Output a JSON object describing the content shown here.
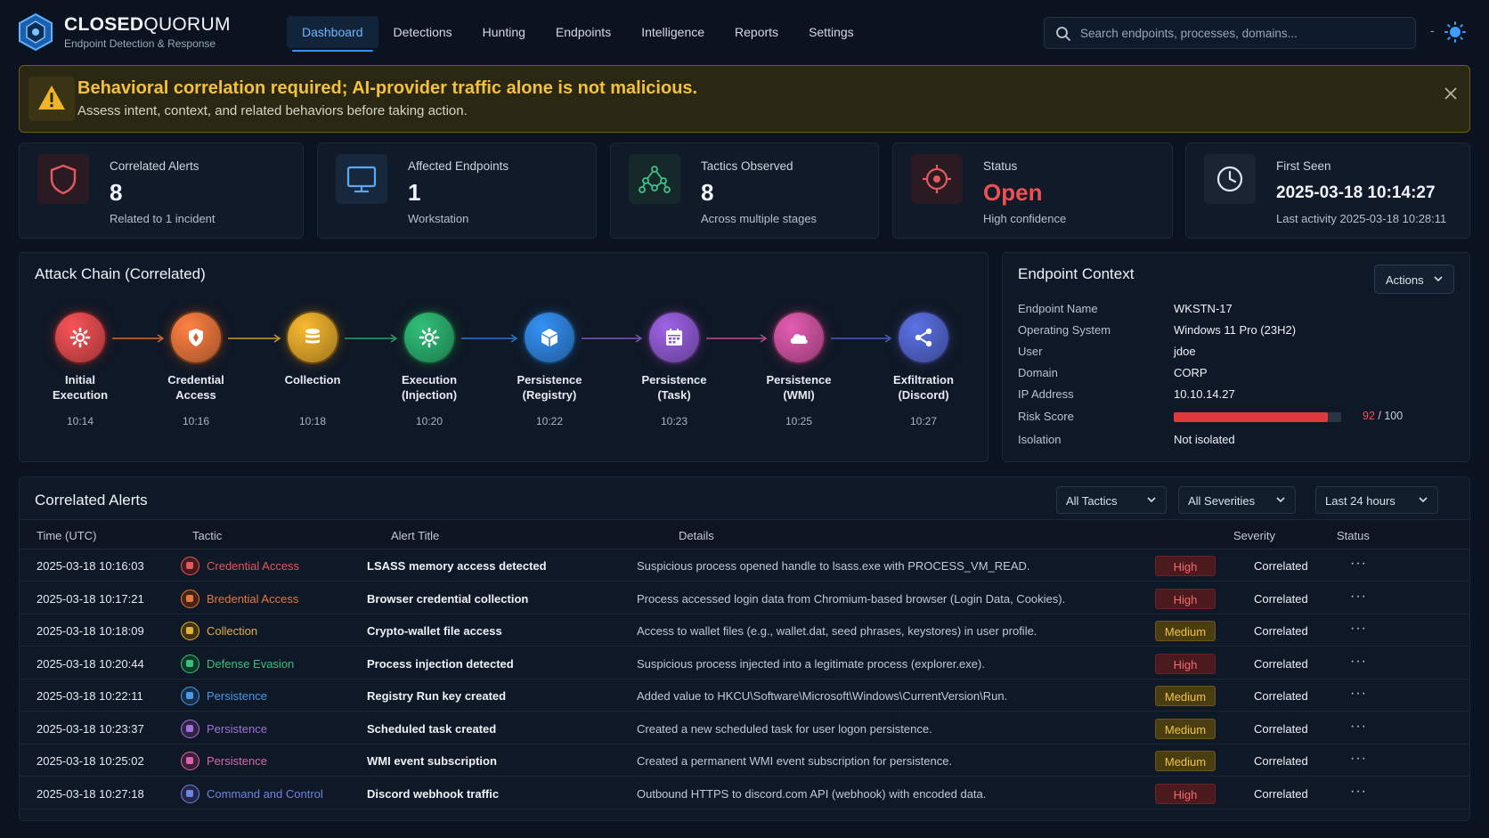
{
  "app": {
    "brand_bold": "CLOSED",
    "brand_thin": "QUORUM",
    "subtitle": "Endpoint Detection & Response"
  },
  "nav": [
    "Dashboard",
    "Detections",
    "Hunting",
    "Endpoints",
    "Intelligence",
    "Reports",
    "Settings"
  ],
  "search": {
    "placeholder": "Search endpoints, processes, domains..."
  },
  "theme_sep": "-",
  "banner": {
    "title": "Behavioral correlation required; AI-provider traffic alone is not malicious.",
    "subtitle": "Assess intent, context, and related behaviors before taking action."
  },
  "stats": [
    {
      "label": "Correlated Alerts",
      "value": "8",
      "sub": "Related to 1 incident",
      "icon": "shield-icon"
    },
    {
      "label": "Affected Endpoints",
      "value": "1",
      "sub": "Workstation",
      "icon": "monitor-icon"
    },
    {
      "label": "Tactics Observed",
      "value": "8",
      "sub": "Across multiple stages",
      "icon": "network-icon"
    },
    {
      "label": "Status",
      "value": "Open",
      "sub": "High confidence",
      "icon": "target-icon"
    },
    {
      "label": "First Seen",
      "value": "2025-03-18 10:14:27",
      "sub": "Last activity 2025-03-18 10:28:11",
      "icon": "clock-icon"
    }
  ],
  "attack_chain": {
    "title": "Attack Chain (Correlated)",
    "nodes": [
      {
        "line1": "Initial",
        "line2": "Execution",
        "time": "10:14",
        "color": "#d9484c",
        "icon": "gear-icon"
      },
      {
        "line1": "Credential",
        "line2": "Access",
        "time": "10:16",
        "color": "#e0713a",
        "icon": "shield-icon"
      },
      {
        "line1": "Collection",
        "line2": "",
        "time": "10:18",
        "color": "#d9a22a",
        "icon": "database-icon"
      },
      {
        "line1": "Execution",
        "line2": "(Injection)",
        "time": "10:20",
        "color": "#2aa86a",
        "icon": "gear-icon"
      },
      {
        "line1": "Persistence",
        "line2": "(Registry)",
        "time": "10:22",
        "color": "#2d7fd6",
        "icon": "cube-icon"
      },
      {
        "line1": "Persistence",
        "line2": "(Task)",
        "time": "10:23",
        "color": "#8a56c9",
        "icon": "calendar-icon"
      },
      {
        "line1": "Persistence",
        "line2": "(WMI)",
        "time": "10:25",
        "color": "#c7509b",
        "icon": "cloud-icon"
      },
      {
        "line1": "Exfiltration",
        "line2": "(Discord)",
        "time": "10:27",
        "color": "#4f63c8",
        "icon": "share-icon"
      }
    ]
  },
  "endpoint": {
    "title": "Endpoint Context",
    "actions": "Actions",
    "rows": [
      {
        "key": "Endpoint Name",
        "value": "WKSTN-17"
      },
      {
        "key": "Operating System",
        "value": "Windows 11 Pro (23H2)"
      },
      {
        "key": "User",
        "value": "jdoe"
      },
      {
        "key": "Domain",
        "value": "CORP"
      },
      {
        "key": "IP Address",
        "value": "10.10.14.27"
      }
    ],
    "risk": {
      "key": "Risk Score",
      "score": "92",
      "max": "/ 100",
      "fraction": 0.92
    },
    "isolation": {
      "key": "Isolation",
      "value": "Not isolated"
    }
  },
  "alerts": {
    "title": "Correlated Alerts",
    "filters": [
      "All Tactics",
      "All Severities",
      "Last 24 hours"
    ],
    "columns": [
      "Time (UTC)",
      "Tactic",
      "Alert Title",
      "Details",
      "Severity",
      "Status"
    ],
    "more_icon": "···",
    "rows": [
      {
        "time": "2025-03-18 10:16:03",
        "tactic": "Credential Access",
        "tactic_color": "#e2585d",
        "title": "LSASS memory access detected",
        "details": "Suspicious process opened handle to lsass.exe with PROCESS_VM_READ.",
        "severity": "High",
        "status": "Correlated"
      },
      {
        "time": "2025-03-18 10:17:21",
        "tactic": "Bredential Access",
        "tactic_color": "#e4773f",
        "title": "Browser credential collection",
        "details": "Process accessed login data from Chromium-based browser (Login Data, Cookies).",
        "severity": "High",
        "status": "Correlated"
      },
      {
        "time": "2025-03-18 10:18:09",
        "tactic": "Collection",
        "tactic_color": "#e1b13a",
        "title": "Crypto-wallet file access",
        "details": "Access to wallet files (e.g., wallet.dat, seed phrases, keystores) in user profile.",
        "severity": "Medium",
        "status": "Correlated"
      },
      {
        "time": "2025-03-18 10:20:44",
        "tactic": "Defense Evasion",
        "tactic_color": "#39c07f",
        "title": "Process injection detected",
        "details": "Suspicious process injected into a legitimate process (explorer.exe).",
        "severity": "High",
        "status": "Correlated"
      },
      {
        "time": "2025-03-18 10:22:11",
        "tactic": "Persistence",
        "tactic_color": "#4a98ea",
        "title": "Registry Run key created",
        "details": "Added value to HKCU\\Software\\Microsoft\\Windows\\CurrentVersion\\Run.",
        "severity": "Medium",
        "status": "Correlated"
      },
      {
        "time": "2025-03-18 10:23:37",
        "tactic": "Persistence",
        "tactic_color": "#a070dc",
        "title": "Scheduled task created",
        "details": "Created a new scheduled task for user logon persistence.",
        "severity": "Medium",
        "status": "Correlated"
      },
      {
        "time": "2025-03-18 10:25:02",
        "tactic": "Persistence",
        "tactic_color": "#d568ac",
        "title": "WMI event subscription",
        "details": "Created a permanent WMI event subscription for persistence.",
        "severity": "Medium",
        "status": "Correlated"
      },
      {
        "time": "2025-03-18 10:27:18",
        "tactic": "Command and Control",
        "tactic_color": "#6f83e6",
        "title": "Discord webhook traffic",
        "details": "Outbound HTTPS to discord.com API (webhook) with encoded data.",
        "severity": "High",
        "status": "Correlated"
      }
    ]
  }
}
